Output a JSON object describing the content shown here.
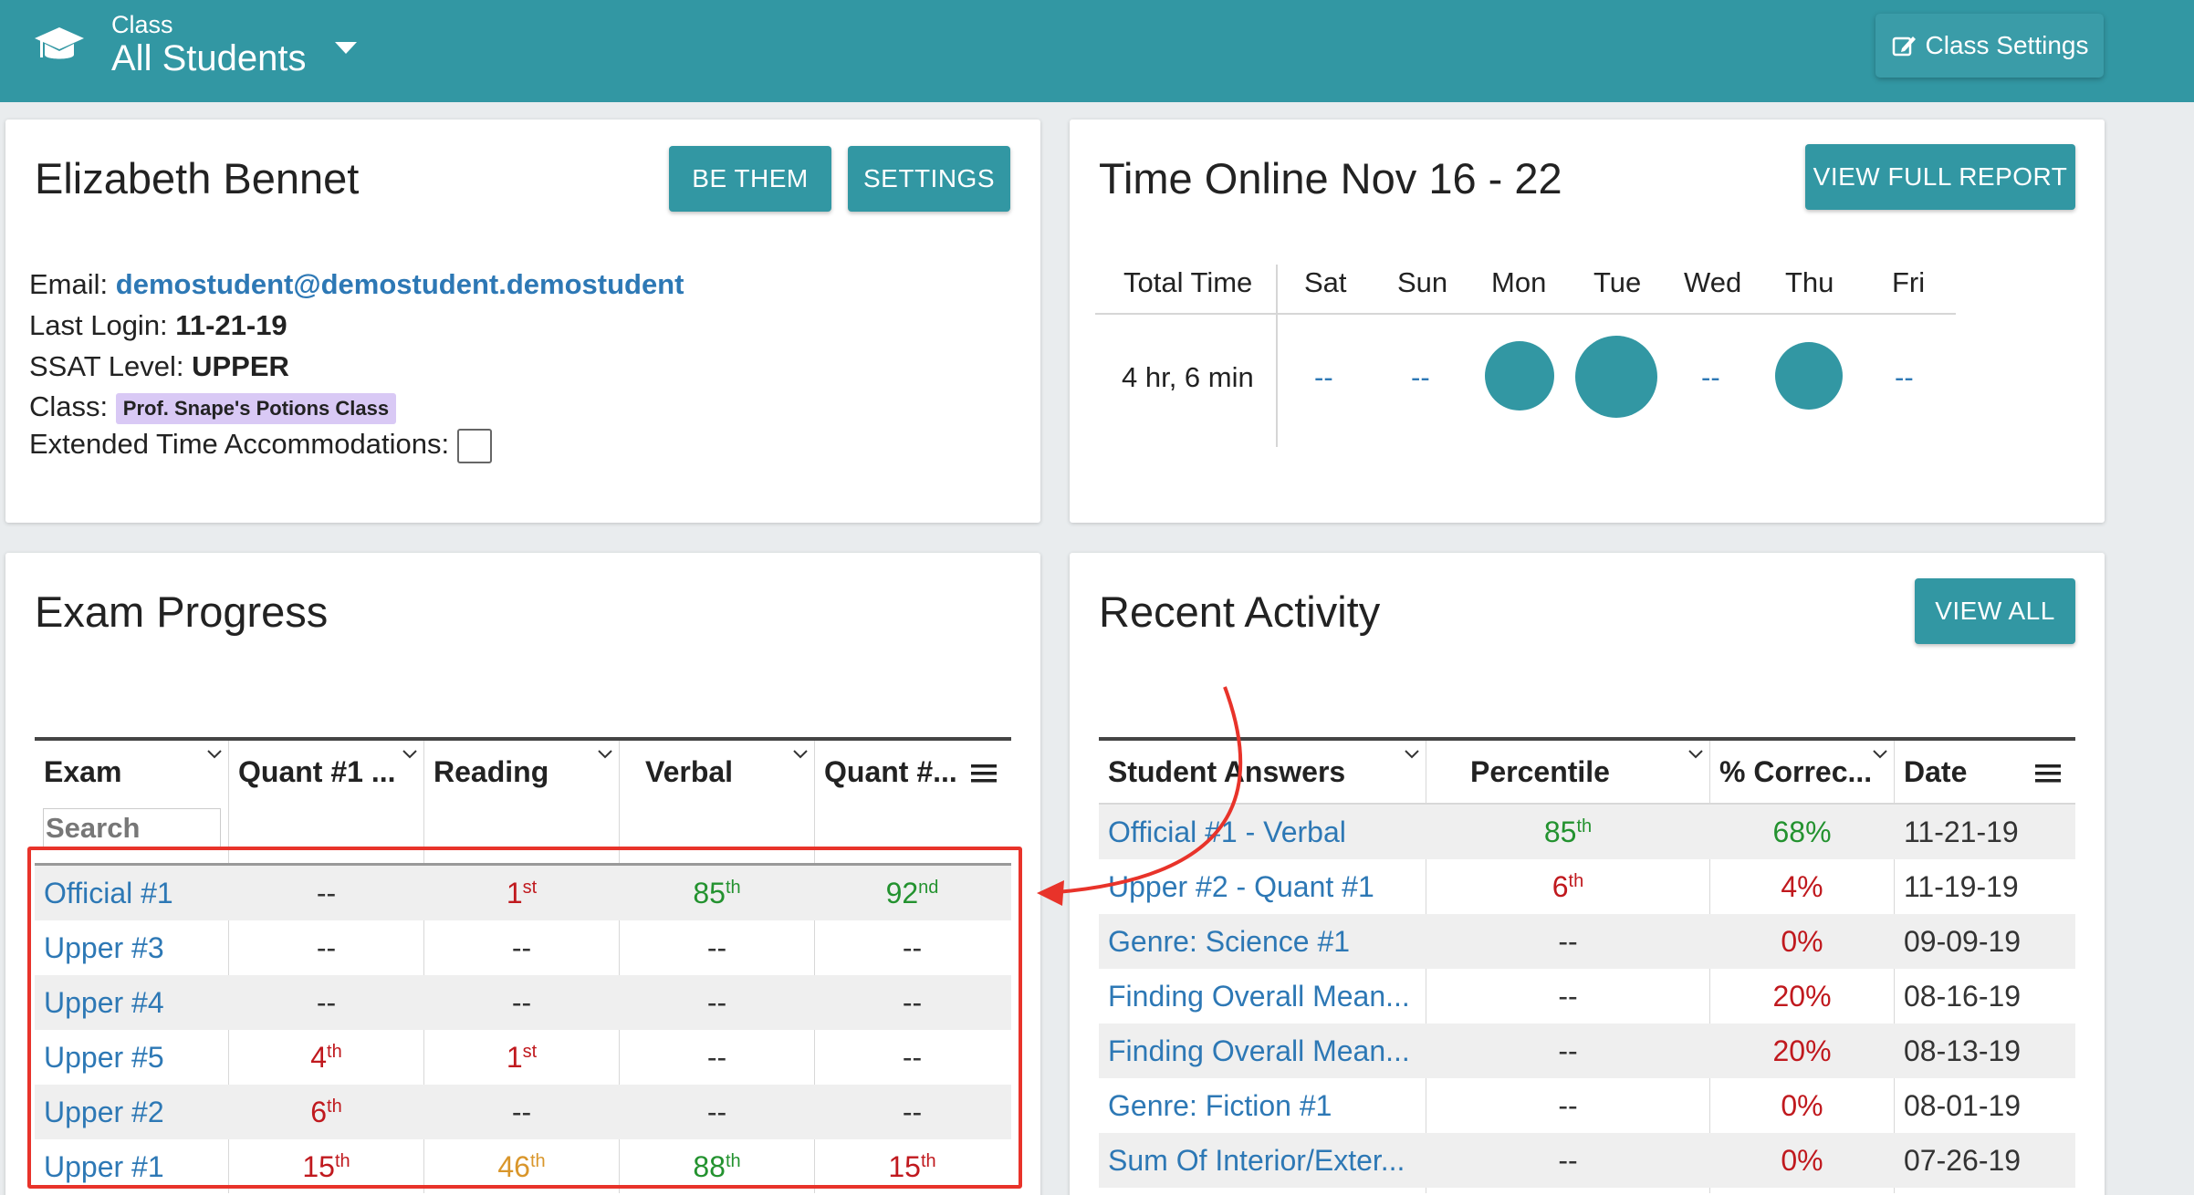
{
  "header": {
    "class_label": "Class",
    "class_value": "All Students",
    "settings_button": "Class Settings",
    "colors": {
      "bar": "#3297a3",
      "link": "#2d78b5"
    }
  },
  "student": {
    "name": "Elizabeth Bennet",
    "be_them": "BE THEM",
    "settings": "SETTINGS",
    "email_label": "Email:",
    "email": "demostudent@demostudent.demostudent",
    "login_label": "Last Login:",
    "login": "11-21-19",
    "level_label": "SSAT Level:",
    "level": "UPPER",
    "class_label": "Class:",
    "class_badge": "Prof. Snape's Potions Class",
    "extended_label": "Extended Time Accommodations:",
    "extended_checked": false
  },
  "time_online": {
    "title": "Time Online Nov 16 - 22",
    "report_button": "VIEW FULL REPORT",
    "total_header": "Total Time",
    "total": "4 hr, 6 min",
    "days": [
      "Sat",
      "Sun",
      "Mon",
      "Tue",
      "Wed",
      "Thu",
      "Fri"
    ],
    "day_values": [
      "--",
      "--",
      "",
      "",
      "--",
      "",
      "--"
    ]
  },
  "exam_progress": {
    "title": "Exam Progress",
    "search_placeholder": "Search",
    "columns": [
      "Exam",
      "Quant #1 ...",
      "Reading",
      "Verbal",
      "Quant #..."
    ],
    "rows": [
      {
        "exam": "Official #1",
        "cells": [
          [
            "--",
            ""
          ],
          [
            "1",
            "st"
          ],
          [
            "85",
            "th"
          ],
          [
            "92",
            "nd"
          ]
        ],
        "colors": [
          "dark",
          "red",
          "green",
          "green"
        ]
      },
      {
        "exam": "Upper #3",
        "cells": [
          [
            "--",
            ""
          ],
          [
            "--",
            ""
          ],
          [
            "--",
            ""
          ],
          [
            "--",
            ""
          ]
        ],
        "colors": [
          "dark",
          "dark",
          "dark",
          "dark"
        ]
      },
      {
        "exam": "Upper #4",
        "cells": [
          [
            "--",
            ""
          ],
          [
            "--",
            ""
          ],
          [
            "--",
            ""
          ],
          [
            "--",
            ""
          ]
        ],
        "colors": [
          "dark",
          "dark",
          "dark",
          "dark"
        ]
      },
      {
        "exam": "Upper #5",
        "cells": [
          [
            "4",
            "th"
          ],
          [
            "1",
            "st"
          ],
          [
            "--",
            ""
          ],
          [
            "--",
            ""
          ]
        ],
        "colors": [
          "red",
          "red",
          "dark",
          "dark"
        ]
      },
      {
        "exam": "Upper #2",
        "cells": [
          [
            "6",
            "th"
          ],
          [
            "--",
            ""
          ],
          [
            "--",
            ""
          ],
          [
            "--",
            ""
          ]
        ],
        "colors": [
          "red",
          "dark",
          "dark",
          "dark"
        ]
      },
      {
        "exam": "Upper #1",
        "cells": [
          [
            "15",
            "th"
          ],
          [
            "46",
            "th"
          ],
          [
            "88",
            "th"
          ],
          [
            "15",
            "th"
          ]
        ],
        "colors": [
          "red",
          "orange",
          "green",
          "red"
        ]
      }
    ]
  },
  "recent_activity": {
    "title": "Recent Activity",
    "view_all": "VIEW ALL",
    "columns": [
      "Student Answers",
      "Percentile",
      "% Correc...",
      "Date"
    ],
    "rows": [
      {
        "name": "Official #1 - Verbal",
        "pct": [
          "85",
          "th"
        ],
        "pct_color": "green",
        "correct": "68%",
        "correct_color": "green",
        "date": "11-21-19"
      },
      {
        "name": "Upper #2 - Quant #1",
        "pct": [
          "6",
          "th"
        ],
        "pct_color": "red",
        "correct": "4%",
        "correct_color": "red",
        "date": "11-19-19"
      },
      {
        "name": "Genre: Science #1",
        "pct": [
          "--",
          ""
        ],
        "pct_color": "dark",
        "correct": "0%",
        "correct_color": "red",
        "date": "09-09-19"
      },
      {
        "name": "Finding Overall Mean...",
        "pct": [
          "--",
          ""
        ],
        "pct_color": "dark",
        "correct": "20%",
        "correct_color": "red",
        "date": "08-16-19"
      },
      {
        "name": "Finding Overall Mean...",
        "pct": [
          "--",
          ""
        ],
        "pct_color": "dark",
        "correct": "20%",
        "correct_color": "red",
        "date": "08-13-19"
      },
      {
        "name": "Genre: Fiction #1",
        "pct": [
          "--",
          ""
        ],
        "pct_color": "dark",
        "correct": "0%",
        "correct_color": "red",
        "date": "08-01-19"
      },
      {
        "name": "Sum Of Interior/Exter...",
        "pct": [
          "--",
          ""
        ],
        "pct_color": "dark",
        "correct": "0%",
        "correct_color": "red",
        "date": "07-26-19"
      }
    ]
  }
}
